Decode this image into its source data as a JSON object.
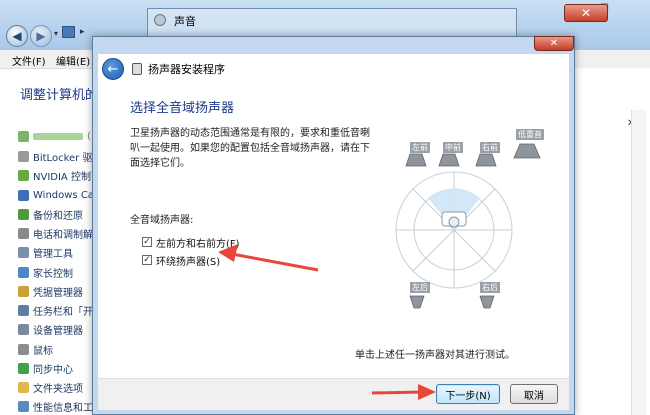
{
  "control_panel": {
    "menu": [
      "文件(F)",
      "编辑(E)"
    ],
    "heading": "调整计算机的设",
    "items": [
      {
        "label": "",
        "icon": "blurred-item-icon"
      },
      {
        "label": "BitLocker 驱动",
        "icon": "bitlocker-icon"
      },
      {
        "label": "NVIDIA 控制面",
        "icon": "nvidia-icon"
      },
      {
        "label": "Windows Card",
        "icon": "windows-cardspace-icon"
      },
      {
        "label": "备份和还原",
        "icon": "backup-icon"
      },
      {
        "label": "电话和调制解",
        "icon": "phone-modem-icon"
      },
      {
        "label": "管理工具",
        "icon": "admin-tools-icon"
      },
      {
        "label": "家长控制",
        "icon": "parental-controls-icon"
      },
      {
        "label": "凭据管理器",
        "icon": "credential-manager-icon"
      },
      {
        "label": "任务栏和「开",
        "icon": "taskbar-icon"
      },
      {
        "label": "设备管理器",
        "icon": "device-manager-icon"
      },
      {
        "label": "鼠标",
        "icon": "mouse-icon"
      },
      {
        "label": "同步中心",
        "icon": "sync-center-icon"
      },
      {
        "label": "文件夹选项",
        "icon": "folder-options-icon"
      },
      {
        "label": "性能信息和工",
        "icon": "performance-icon"
      }
    ]
  },
  "sound_dialog": {
    "title": "声音"
  },
  "wizard": {
    "title": "扬声器安装程序",
    "heading": "选择全音域扬声器",
    "description": "卫星扬声器的动态范围通常是有限的，要求和重低音喇叭一起使用。如果您的配置包括全音域扬声器，请在下面选择它们。",
    "group_label": "全音域扬声器:",
    "options": [
      {
        "label": "左前方和右前方(F)",
        "checked": true
      },
      {
        "label": "环绕扬声器(S)",
        "checked": true
      }
    ],
    "speaker_labels": {
      "front_left": "左前",
      "center": "中前",
      "front_right": "右前",
      "subwoofer": "低重音",
      "surround_left": "左后",
      "surround_right": "右后"
    },
    "hint": "单击上述任一扬声器对其进行测试。",
    "next_label": "下一步(N)",
    "cancel_label": "取消",
    "back_symbol": "←",
    "close_symbol": "✕"
  },
  "colors": {
    "accent_heading": "#1e3a8a",
    "arrow": "#e8463a",
    "frame": "#c3d7ee"
  }
}
